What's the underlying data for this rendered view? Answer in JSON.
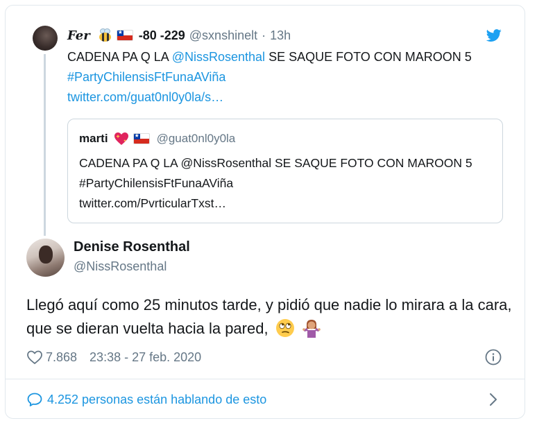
{
  "parent": {
    "name": "Fer",
    "emoji": [
      "bee",
      "chile-flag"
    ],
    "score": "-80 -229",
    "handle": "@sxnshinelt",
    "separator": "·",
    "time": "13h",
    "text_plain": "CADENA PA Q LA ",
    "mention": "@NissRosenthal",
    "text_mid": " SE SAQUE FOTO CON MAROON 5 ",
    "hashtag": "#PartyChilensisFtFunaAViña",
    "link": "twitter.com/guat0nl0y0la/s…"
  },
  "quote": {
    "name": "marti",
    "emoji": [
      "sparkling-heart",
      "chile-flag"
    ],
    "handle": "@guat0nl0y0la",
    "text": "CADENA PA Q LA @NissRosenthal SE SAQUE FOTO CON MAROON 5 #PartyChilensisFtFunaAViña",
    "link": "twitter.com/PvrticularTxst…"
  },
  "main": {
    "name": "Denise Rosenthal",
    "handle": "@NissRosenthal",
    "text": "Llegó aquí como 25 minutos tarde, y pidió que nadie lo mirara a la cara, que se dieran vuelta hacia la pared,",
    "emoji": [
      "face-with-rolling-eyes",
      "person-shrugging"
    ],
    "likes": "7.868",
    "timestamp": "23:38 - 27 feb. 2020"
  },
  "footer": {
    "talking": "4.252 personas están hablando de esto"
  },
  "icons": {
    "brand": "twitter-bird-icon",
    "like": "heart-outline-icon",
    "info": "info-circle-icon",
    "reply": "speech-bubble-icon",
    "next": "chevron-right-icon"
  },
  "colors": {
    "link": "#1b95e0",
    "muted": "#657786",
    "text": "#14171a",
    "border": "#e1e8ed"
  }
}
